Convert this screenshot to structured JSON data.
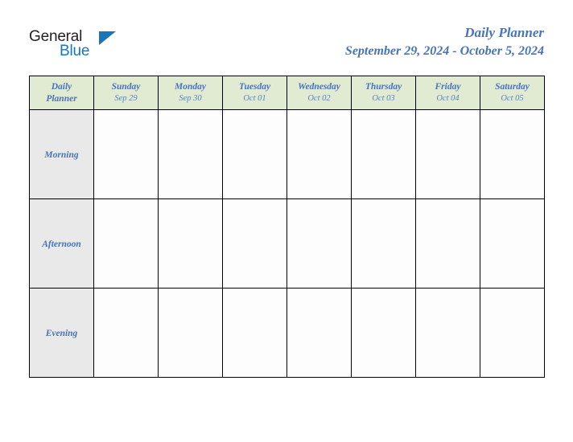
{
  "brand": {
    "name_part1": "General",
    "name_part2": "Blue",
    "triangle_icon": "triangle-right-icon",
    "part1_color": "#231f20",
    "part2_color": "#1477c4",
    "triangle_color": "#1c74bb"
  },
  "header": {
    "title": "Daily Planner",
    "date_range": "September 29, 2024 - October 5, 2024",
    "title_color": "#4774b8"
  },
  "table": {
    "corner": {
      "line1": "Daily",
      "line2": "Planner"
    },
    "header_bg": "#e1ebd2",
    "row_label_bg": "#e9e9e9",
    "cell_bg": "#fdfdfd",
    "border_color": "#000000",
    "columns": [
      {
        "day": "Sunday",
        "date": "Sep 29"
      },
      {
        "day": "Monday",
        "date": "Sep 30"
      },
      {
        "day": "Tuesday",
        "date": "Oct 01"
      },
      {
        "day": "Wednesday",
        "date": "Oct 02"
      },
      {
        "day": "Thursday",
        "date": "Oct 03"
      },
      {
        "day": "Friday",
        "date": "Oct 04"
      },
      {
        "day": "Saturday",
        "date": "Oct 05"
      }
    ],
    "rows": [
      {
        "label": "Morning",
        "cells": [
          "",
          "",
          "",
          "",
          "",
          "",
          ""
        ]
      },
      {
        "label": "Afternoon",
        "cells": [
          "",
          "",
          "",
          "",
          "",
          "",
          ""
        ]
      },
      {
        "label": "Evening",
        "cells": [
          "",
          "",
          "",
          "",
          "",
          "",
          ""
        ]
      }
    ]
  }
}
